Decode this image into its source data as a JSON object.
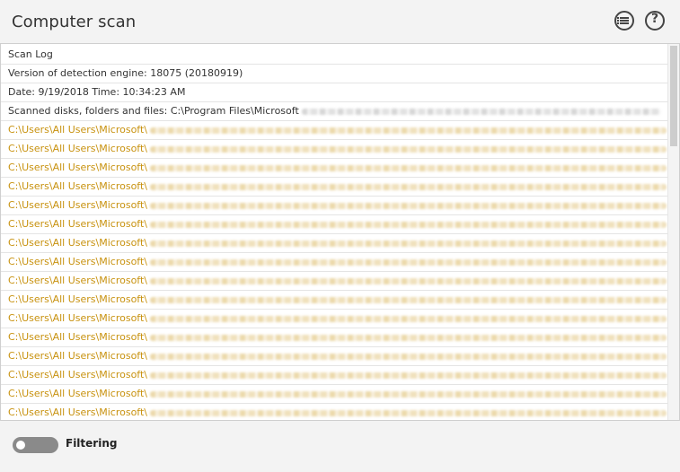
{
  "header": {
    "title": "Computer scan",
    "list_icon": "list-icon",
    "help_icon": "help-icon"
  },
  "log": {
    "info_rows": [
      "Scan Log",
      "Version of detection engine: 18075 (20180919)",
      "Date: 9/19/2018  Time: 10:34:23 AM",
      "Scanned disks, folders and files: C:\\Program Files\\Microsoft"
    ],
    "threat_rows": [
      "C:\\Users\\All Users\\Microsoft\\",
      "C:\\Users\\All Users\\Microsoft\\",
      "C:\\Users\\All Users\\Microsoft\\",
      "C:\\Users\\All Users\\Microsoft\\",
      "C:\\Users\\All Users\\Microsoft\\",
      "C:\\Users\\All Users\\Microsoft\\",
      "C:\\Users\\All Users\\Microsoft\\",
      "C:\\Users\\All Users\\Microsoft\\",
      "C:\\Users\\All Users\\Microsoft\\",
      "C:\\Users\\All Users\\Microsoft\\",
      "C:\\Users\\All Users\\Microsoft\\",
      "C:\\Users\\All Users\\Microsoft\\",
      "C:\\Users\\All Users\\Microsoft\\",
      "C:\\Users\\All Users\\Microsoft\\",
      "C:\\Users\\All Users\\Microsoft\\",
      "C:\\Users\\All Users\\Microsoft\\"
    ],
    "threat_color": "#c8920f"
  },
  "footer": {
    "filtering_label": "Filtering",
    "filtering_on": false
  }
}
